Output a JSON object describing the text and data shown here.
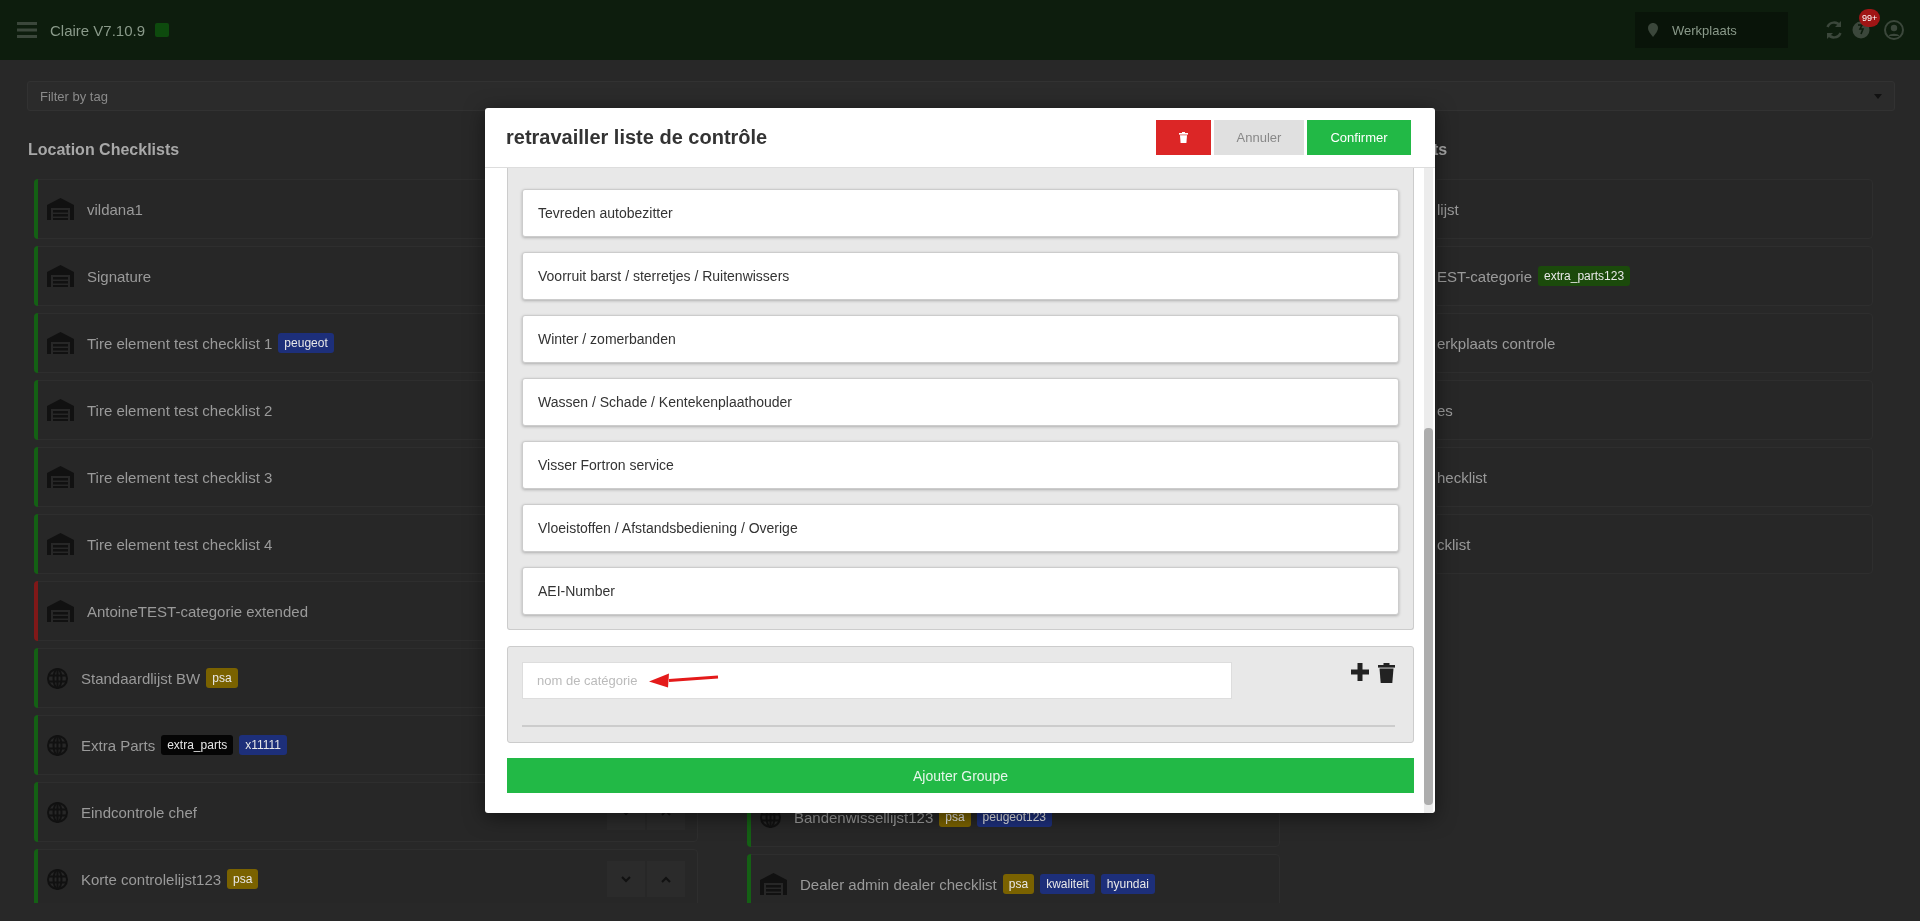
{
  "app_bar": {
    "title": "Claire V7.10.9",
    "location": "Werkplaats",
    "notification_badge": "99+"
  },
  "filter": {
    "placeholder": "Filter by tag"
  },
  "left_column": {
    "heading": "Location Checklists",
    "items": [
      {
        "name": "vildana1",
        "kind": "location",
        "color": "#146014"
      },
      {
        "name": "Signature",
        "kind": "location",
        "color": "#146014"
      },
      {
        "name": "Tire element test checklist 1",
        "kind": "location",
        "color": "#146014",
        "tags": [
          {
            "label": "peugeot",
            "color": "#1d2f7a"
          }
        ]
      },
      {
        "name": "Tire element test checklist 2",
        "kind": "location",
        "color": "#146014"
      },
      {
        "name": "Tire element test checklist 3",
        "kind": "location",
        "color": "#146014"
      },
      {
        "name": "Tire element test checklist 4",
        "kind": "location",
        "color": "#146014"
      },
      {
        "name": "AntoineTEST-categorie extended",
        "kind": "location",
        "color": "#801818"
      },
      {
        "name": "Standaardlijst BW",
        "kind": "global",
        "color": "#146014",
        "tags": [
          {
            "label": "psa",
            "color": "#7a6200"
          }
        ]
      },
      {
        "name": "Extra Parts",
        "kind": "global",
        "color": "#146014",
        "tags": [
          {
            "label": "extra_parts",
            "color": "#050505"
          },
          {
            "label": "x11111",
            "color": "#1d2f7a"
          }
        ]
      },
      {
        "name": "Eindcontrole chef",
        "kind": "global",
        "color": "#146014",
        "reorder_buttons": true
      },
      {
        "name": "Korte controlelijst123",
        "kind": "global",
        "color": "#146014",
        "reorder_buttons": true,
        "tags": [
          {
            "label": "psa",
            "color": "#7a6200"
          }
        ]
      }
    ]
  },
  "middle_column": {
    "items": [
      {
        "name": "Bandenwissellijst123",
        "kind": "global",
        "color": "#146014",
        "tags": [
          {
            "label": "psa",
            "color": "#7a6200"
          },
          {
            "label": "peugeot123",
            "color": "#1d2f7a"
          }
        ]
      },
      {
        "name": "Dealer admin dealer checklist",
        "kind": "location",
        "color": "#146014",
        "tags": [
          {
            "label": "psa",
            "color": "#7a6200"
          },
          {
            "label": "kwaliteit",
            "color": "#1d2f7a"
          },
          {
            "label": "hyundai",
            "color": "#1d2f7a"
          }
        ]
      }
    ]
  },
  "right_column": {
    "heading": "ts",
    "items": [
      {
        "name": "lijst"
      },
      {
        "name": "EST-categorie",
        "tags": [
          {
            "label": "extra_parts123",
            "color": "#1b4a0b"
          }
        ]
      },
      {
        "name": "erkplaats controle"
      },
      {
        "name": "es"
      },
      {
        "name": "hecklist"
      },
      {
        "name": "cklist"
      }
    ]
  },
  "modal": {
    "title": "retravailler liste de contrôle",
    "buttons": [
      {
        "kind": "delete"
      },
      {
        "kind": "cancel",
        "label": "Annuler"
      },
      {
        "kind": "confirm",
        "label": "Confirmer"
      }
    ],
    "categories": [
      "Tevreden autobezitter",
      "Voorruit barst / sterretjes / Ruitenwissers",
      "Winter / zomerbanden",
      "Wassen / Schade / Kentekenplaathouder",
      "Visser Fortron service",
      "Vloeistoffen / Afstandsbediening / Overige",
      "AEI-Number"
    ],
    "new_category": {
      "placeholder": "nom de catégorie"
    },
    "add_group_button": "Ajouter Groupe"
  }
}
